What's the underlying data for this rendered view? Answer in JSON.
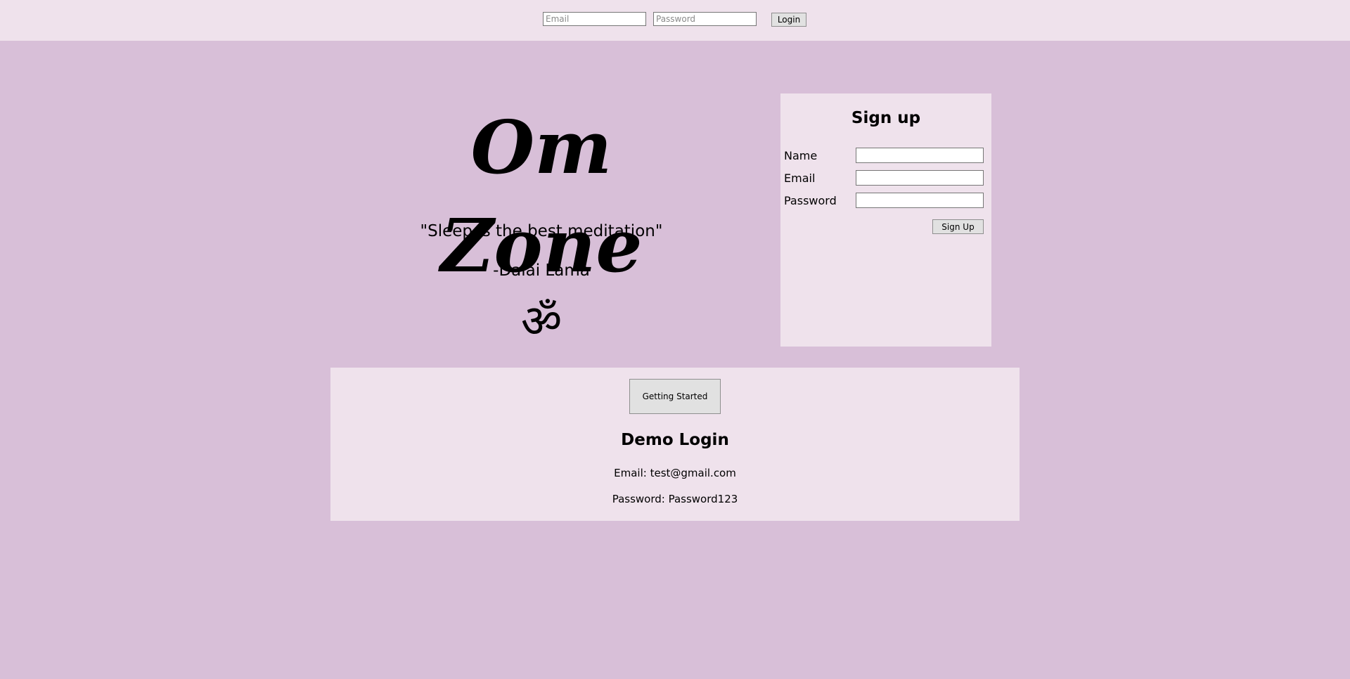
{
  "topbar": {
    "email_placeholder": "Email",
    "password_placeholder": "Password",
    "login_label": "Login"
  },
  "hero": {
    "title": "Om Zone",
    "quote": "\"Sleep is the best meditation\"",
    "author": "-Dalai Lama",
    "symbol": "ॐ"
  },
  "signup": {
    "title": "Sign up",
    "fields": [
      {
        "label": "Name",
        "value": ""
      },
      {
        "label": "Email",
        "value": ""
      },
      {
        "label": "Password",
        "value": ""
      }
    ],
    "button_label": "Sign Up"
  },
  "demo": {
    "button_label": "Getting Started",
    "title": "Demo Login",
    "email_line": "Email: test@gmail.com",
    "password_line": "Password: Password123"
  },
  "colors": {
    "background": "#d8bfd8",
    "panel": "#efe2ec",
    "button": "#e1e1e1"
  }
}
